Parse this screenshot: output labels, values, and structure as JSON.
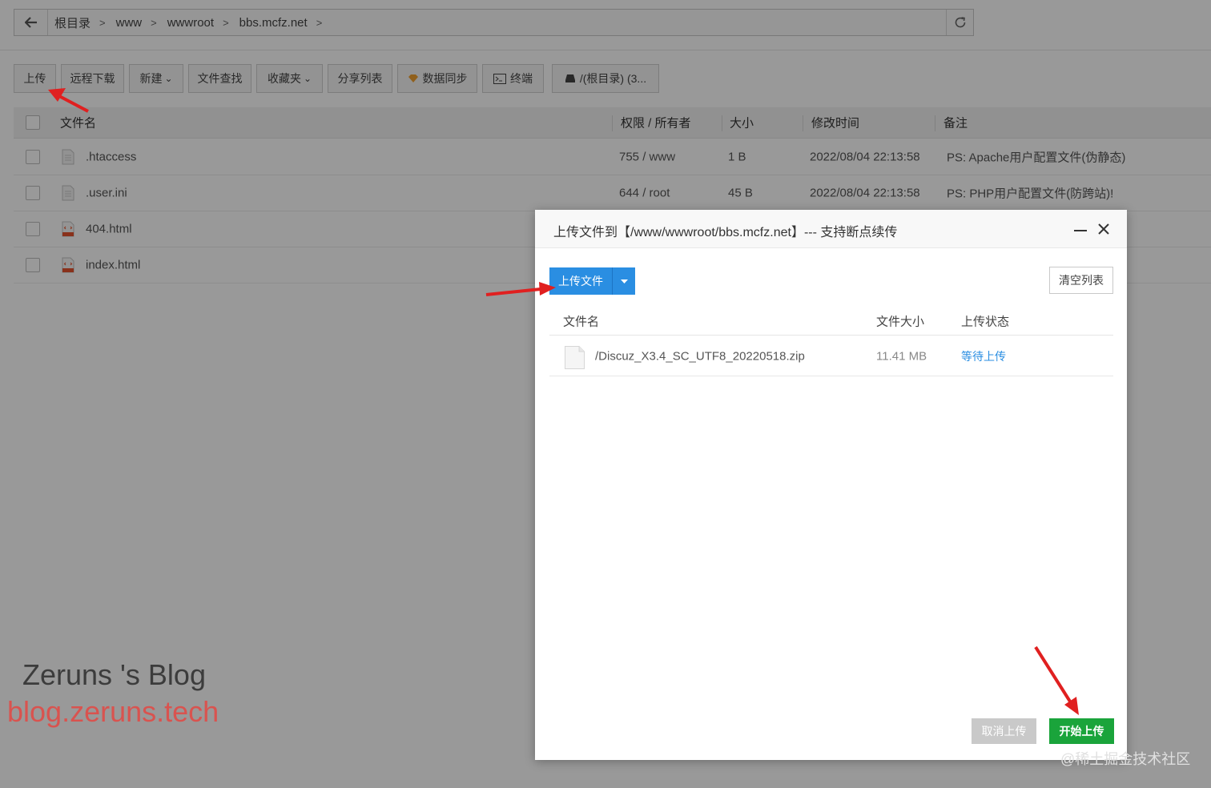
{
  "breadcrumb": [
    "根目录",
    "www",
    "wwwroot",
    "bbs.mcfz.net"
  ],
  "toolbar": {
    "upload": "上传",
    "remote_download": "远程下载",
    "new": "新建",
    "file_search": "文件查找",
    "favorites": "收藏夹",
    "share_list": "分享列表",
    "data_sync": "数据同步",
    "terminal": "终端",
    "disk": "/(根目录) (3..."
  },
  "table": {
    "headers": {
      "name": "文件名",
      "perm": "权限 / 所有者",
      "size": "大小",
      "mtime": "修改时间",
      "note": "备注"
    },
    "rows": [
      {
        "name": ".htaccess",
        "perm": "755 / www",
        "size": "1 B",
        "mtime": "2022/08/04 22:13:58",
        "note": "PS: Apache用户配置文件(伪静态)"
      },
      {
        "name": ".user.ini",
        "perm": "644 / root",
        "size": "45 B",
        "mtime": "2022/08/04 22:13:58",
        "note": "PS: PHP用户配置文件(防跨站)!"
      },
      {
        "name": "404.html"
      },
      {
        "name": "index.html"
      }
    ]
  },
  "modal": {
    "title": "上传文件到【/www/wwwroot/bbs.mcfz.net】--- 支持断点续传",
    "upload_button": "上传文件",
    "clear_button": "清空列表",
    "headers": {
      "name": "文件名",
      "size": "文件大小",
      "status": "上传状态"
    },
    "files": [
      {
        "name": "/Discuz_X3.4_SC_UTF8_20220518.zip",
        "size": "11.41 MB",
        "status": "等待上传"
      }
    ],
    "cancel_button": "取消上传",
    "start_button": "开始上传"
  },
  "watermark": {
    "line1": "Zeruns 's Blog",
    "line2": "blog.zeruns.tech",
    "corner": "@稀土掘金技术社区"
  },
  "colors": {
    "primary": "#2a8ee2",
    "success": "#1aa43b",
    "disabled": "#c9c9c9",
    "link": "#2a8ee2",
    "annotation_arrow": "#e02020",
    "watermark_red": "#d9534f"
  }
}
